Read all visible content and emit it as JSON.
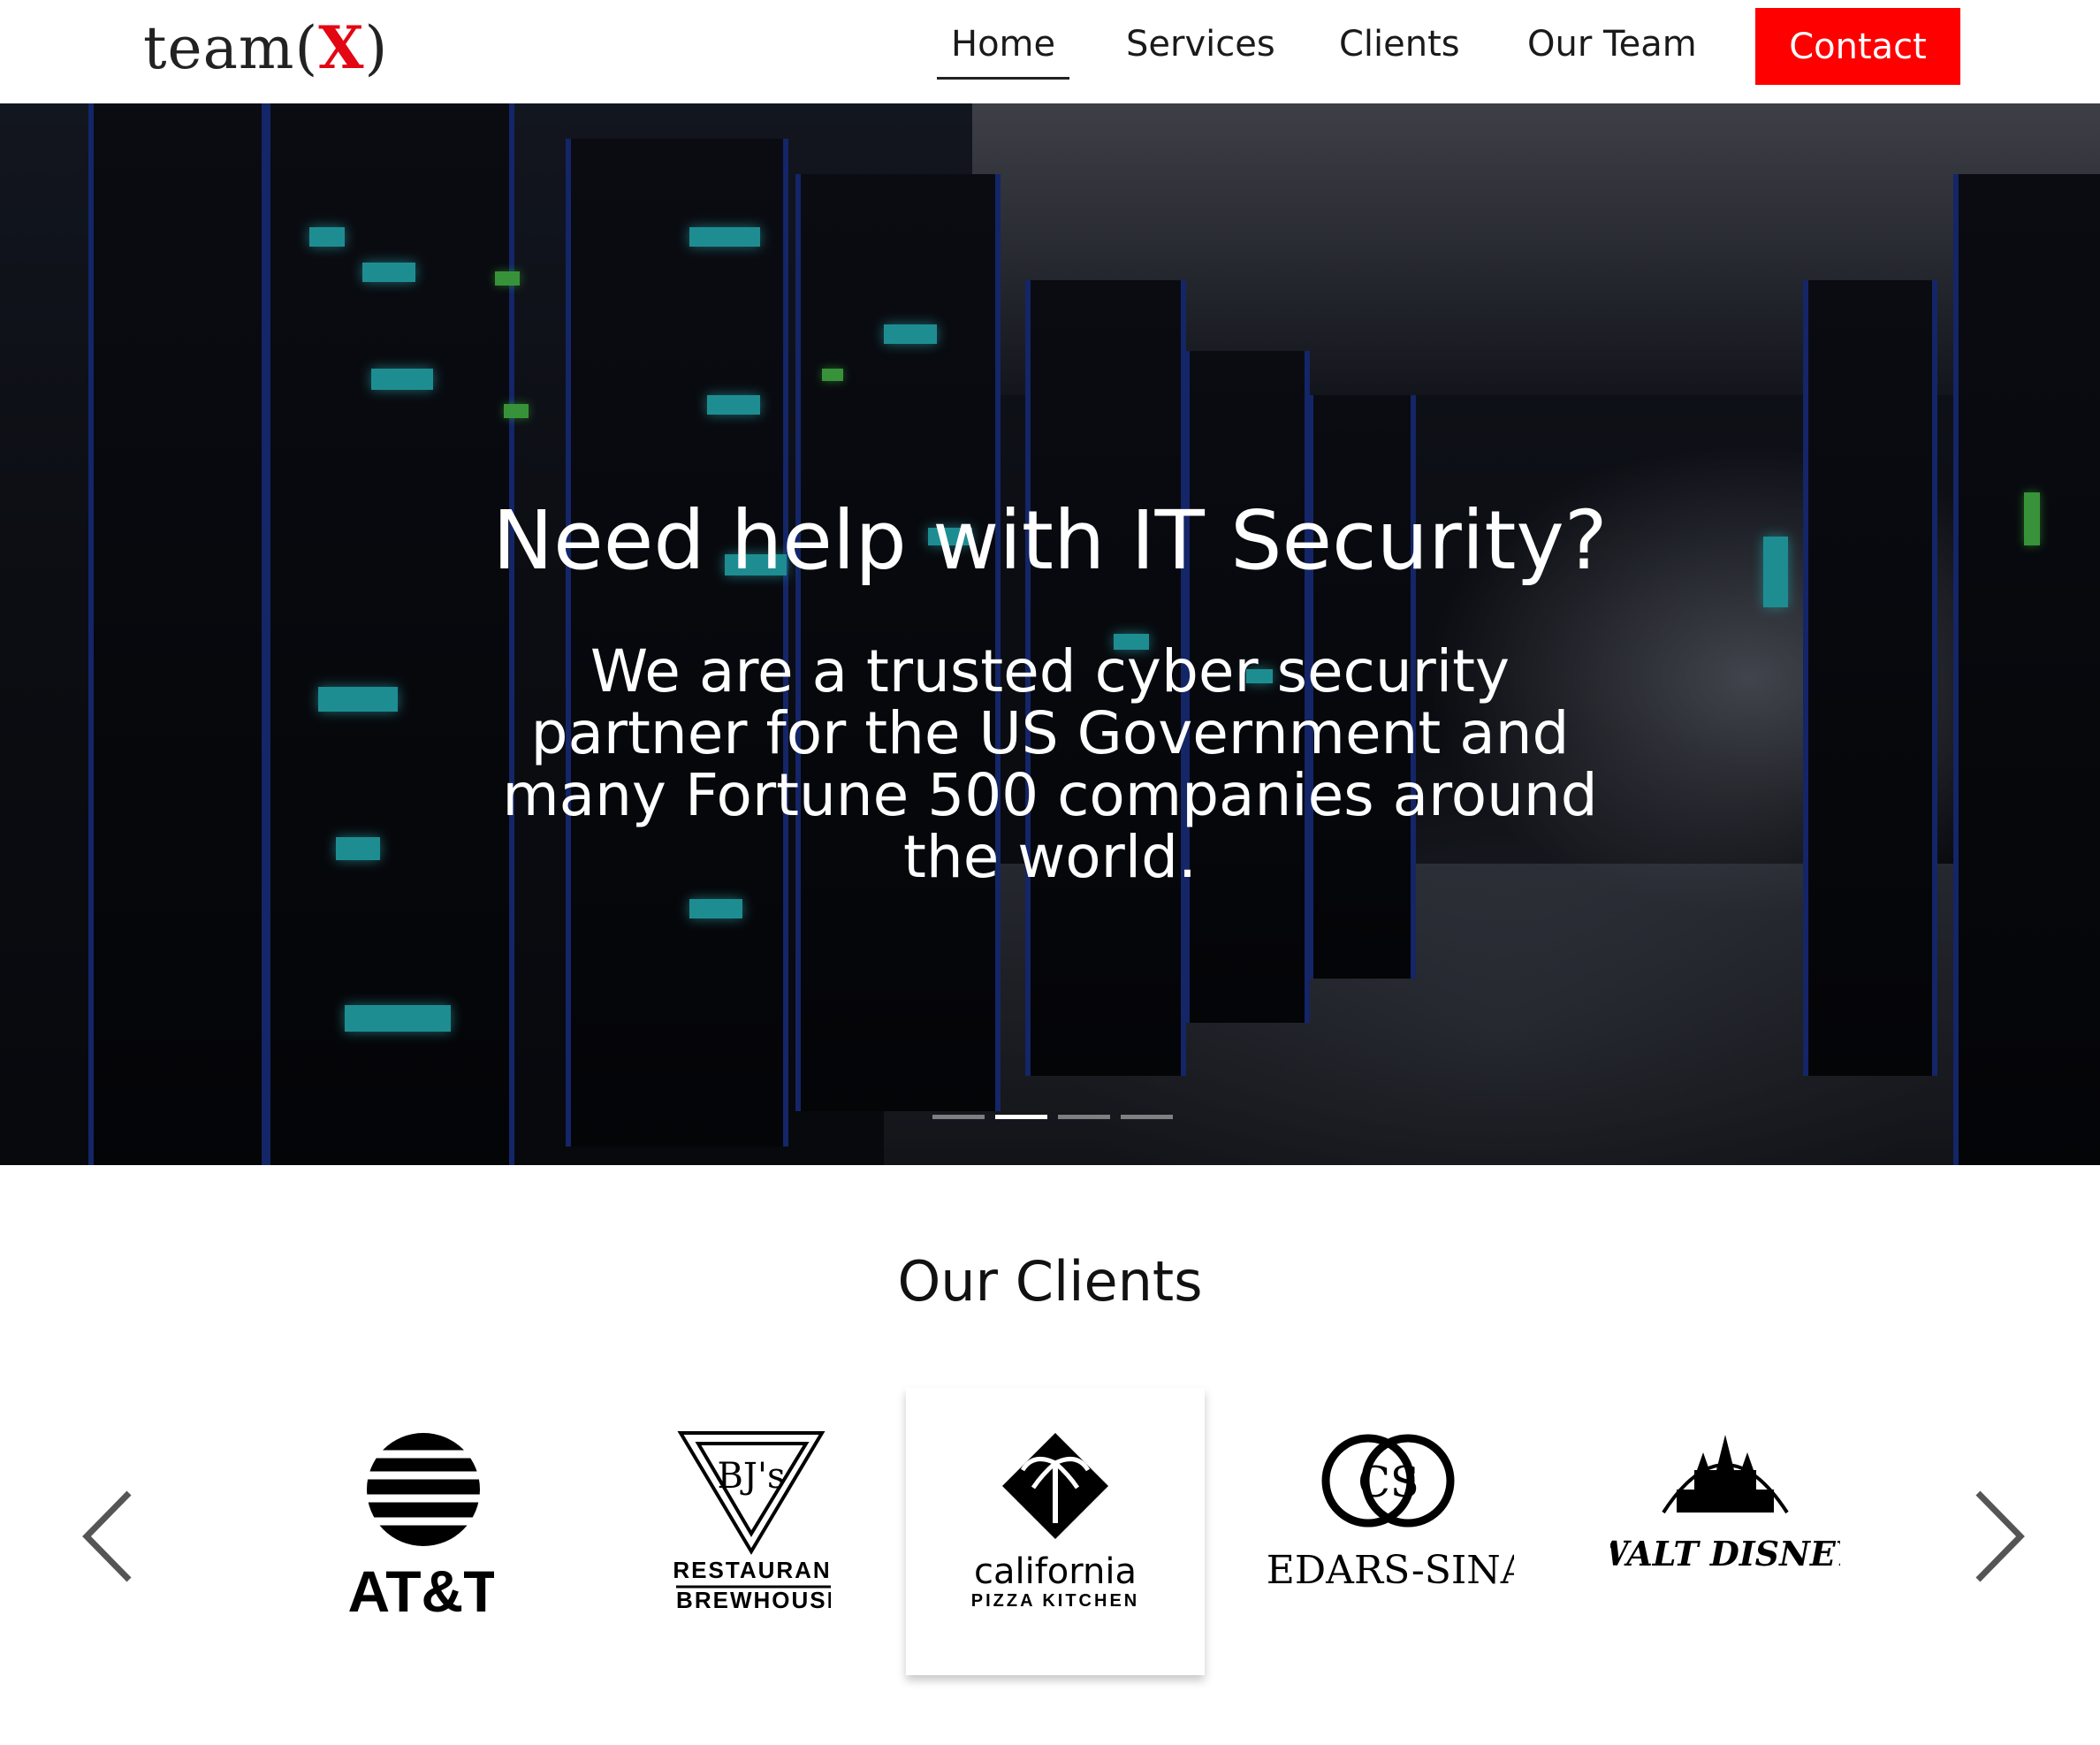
{
  "header": {
    "logo": {
      "prefix": "team(",
      "x": "X",
      "suffix": ")"
    },
    "nav": [
      {
        "label": "Home",
        "active": true
      },
      {
        "label": "Services",
        "active": false
      },
      {
        "label": "Clients",
        "active": false
      },
      {
        "label": "Our Team",
        "active": false
      }
    ],
    "contact_label": "Contact",
    "accent": "#ff0000"
  },
  "hero": {
    "title": "Need help with IT Security?",
    "subtitle_lines": [
      "We are a trusted cyber security",
      "partner for the US Government and",
      "many Fortune 500 companies around",
      "the world."
    ],
    "slides": 4,
    "active_slide": 2
  },
  "clients": {
    "title": "Our Clients",
    "logos": [
      {
        "name": "AT&T",
        "icon": "att-globe-icon",
        "text": "AT&T"
      },
      {
        "name": "BJ's Restaurant Brewhouse",
        "icon": "bjs-shield-icon",
        "line1": "RESTAURANT",
        "line2": "BREWHOUSE"
      },
      {
        "name": "California Pizza Kitchen",
        "icon": "palm-diamond-icon",
        "line1": "california",
        "line2": "PIZZA KITCHEN"
      },
      {
        "name": "Cedars-Sinai",
        "icon": "cs-rings-icon",
        "text": "CEDARS-SINAI"
      },
      {
        "name": "Walt Disney",
        "icon": "castle-icon",
        "text": "WALT DISNEY"
      }
    ],
    "prev": "chevron-left-icon",
    "next": "chevron-right-icon"
  }
}
